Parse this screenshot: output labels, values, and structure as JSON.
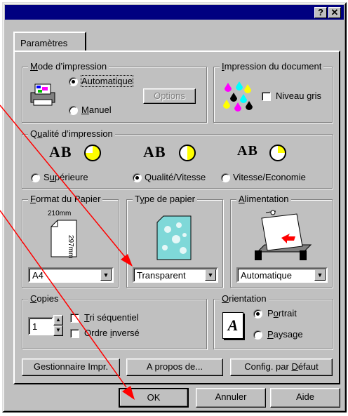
{
  "titlebar": {
    "help_label": "?",
    "close_label": "✕"
  },
  "tab": {
    "label": "Paramètres"
  },
  "mode": {
    "legend_mode": "M",
    "legend_rest": "ode d’impression",
    "auto_label": "Automatique",
    "manual_mnemonic": "M",
    "manual_rest": "anuel",
    "options_label": "Options",
    "selected": "Automatique"
  },
  "document": {
    "legend_mnemonic": "I",
    "legend_rest": "mpression du document",
    "gray_label": "Niveau gris",
    "gray_checked": false
  },
  "quality": {
    "legend_pre": "Q",
    "legend_mnemonic": "u",
    "legend_rest": "alité d’impression",
    "ab_label": "AB",
    "options": [
      {
        "pre": "S",
        "mnemonic": "u",
        "rest": "périeure",
        "selected": false
      },
      {
        "pre": "",
        "mnemonic": "",
        "rest": "Qualité/Vitesse",
        "selected": true
      },
      {
        "pre": "",
        "mnemonic": "",
        "rest": "Vitesse/Economie",
        "selected": false
      }
    ]
  },
  "paper_format": {
    "legend_mnemonic": "F",
    "legend_rest": "ormat du Papier",
    "width_label": "210mm",
    "height_label": "297mm",
    "value": "A4"
  },
  "paper_type": {
    "legend_pre": "T",
    "legend_mnemonic": "y",
    "legend_rest": "pe de papier",
    "value": "Transparent"
  },
  "feed": {
    "legend_mnemonic": "A",
    "legend_rest": "limentation",
    "value": "Automatique"
  },
  "copies": {
    "legend_mnemonic": "C",
    "legend_rest": "opies",
    "value": "1",
    "collate_mnemonic": "T",
    "collate_rest": "ri séquentiel",
    "reverse_pre": "Ordre ",
    "reverse_mnemonic": "i",
    "reverse_rest": "nversé"
  },
  "orientation": {
    "legend_mnemonic": "O",
    "legend_rest": "rientation",
    "icon_letter": "A",
    "portrait_pre": "P",
    "portrait_mnemonic": "o",
    "portrait_rest": "rtrait",
    "landscape_mnemonic": "P",
    "landscape_rest": "aysage",
    "selected": "Portrait"
  },
  "bottom_buttons": {
    "manager_label": "Gestionnaire Impr.",
    "about_label": "A propos de...",
    "default_pre": "Config. par ",
    "default_mnemonic": "D",
    "default_rest": "éfaut"
  },
  "dialog_buttons": {
    "ok_label": "OK",
    "cancel_label": "Annuler",
    "help_label": "Aide"
  },
  "colors": {
    "titlebar": "#000080",
    "face": "#c0c0c0",
    "annotation": "#ff0000"
  }
}
